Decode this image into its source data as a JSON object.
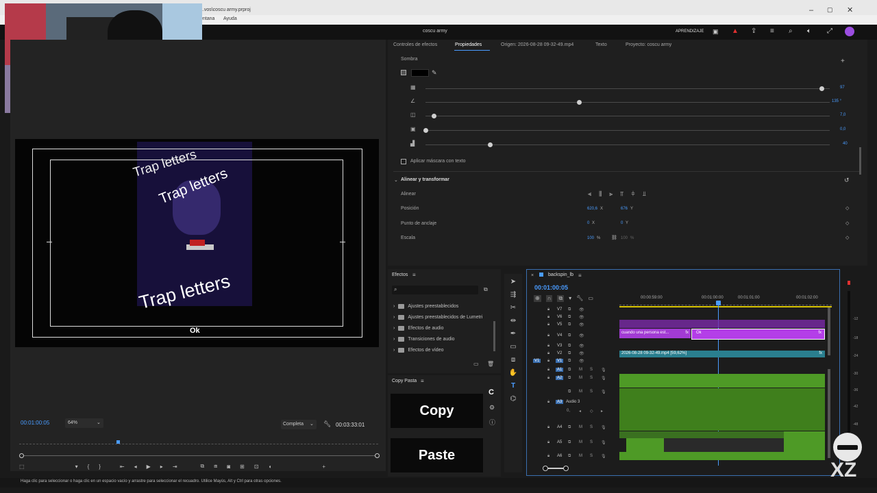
{
  "window": {
    "title": "...vos\\coscu army.prproj",
    "project_name": "coscu army",
    "menu": [
      "entana",
      "Ayuda"
    ],
    "learn_label": "APRENDIZAJE"
  },
  "effect_controls": {
    "tabs": [
      "Controles de efectos",
      "Propiedades",
      "Origen: 2026-08-28 09-32-49.mp4",
      "Texto",
      "Proyecto: coscu army"
    ],
    "section_shadow": "Sombra",
    "shadow_values": [
      "97",
      "135 °",
      "7,0",
      "0,0",
      "40"
    ],
    "mask_label": "Aplicar máscara con texto",
    "align_section": "Alinear y transformar",
    "align_label": "Alinear",
    "position_label": "Posición",
    "position_x": "620,6",
    "position_y": "676",
    "anchor_label": "Punto de anclaje",
    "anchor_x": "0",
    "anchor_y": "0",
    "scale_label": "Escala",
    "scale_value": "100",
    "scale_value2": "100",
    "unit_x": "X",
    "unit_y": "Y",
    "unit_pct": "%"
  },
  "program_monitor": {
    "texts": [
      "Trap letters",
      "Trap letters",
      "Trap letters",
      "Ok"
    ],
    "timecode": "00:01:00:05",
    "zoom": "64%",
    "quality": "Completa",
    "duration": "00:03:33:01"
  },
  "effects_panel": {
    "title": "Efectos",
    "items": [
      "Ajustes preestablecidos",
      "Ajustes preestablecidos de Lumetri",
      "Efectos de audio",
      "Transiciones de audio",
      "Efectos de vídeo"
    ]
  },
  "copy_paste": {
    "title": "Copy Pasta",
    "copy": "Copy",
    "paste": "Paste"
  },
  "timeline": {
    "sequence": "backspin_lb",
    "timecode": "00:01:00:05",
    "ruler": [
      "00:00:59:00",
      "00:01:00:00",
      "00:01:01:00",
      "00:01:02:00"
    ],
    "video_tracks": [
      "V7",
      "V6",
      "V5",
      "V4",
      "V3",
      "V2",
      "V1"
    ],
    "audio_tracks": [
      "A1",
      "A2",
      "A3",
      "A4",
      "A5",
      "A6"
    ],
    "audio3_name": "Audio 3",
    "audio3_vol": "0,",
    "clip_v4a": "cuando una persona est...",
    "clip_v4b": "Ok",
    "clip_v2": "2026-08-28 09-32-49.mp4 [59,62%]",
    "fx": "fx",
    "vu_scale": [
      "-12",
      "-18",
      "-24",
      "-30",
      "-36",
      "-42",
      "-48"
    ]
  },
  "status_bar": "Haga clic para seleccionar o haga clic en un espacio vacío y arrastre para seleccionar el recuadro. Utilice Mayús, Alt y Ctrl para otras opciones.",
  "overlay": {
    "watermark": "XZ"
  },
  "colors": {
    "accent_blue": "#4a9cff",
    "clip_purple": "#a23bd4",
    "clip_teal": "#2a7f8f",
    "audio_green": "#4e9a26"
  },
  "shadow_levels": [
    0.98,
    0.38,
    0.02,
    0.0,
    0.16
  ]
}
